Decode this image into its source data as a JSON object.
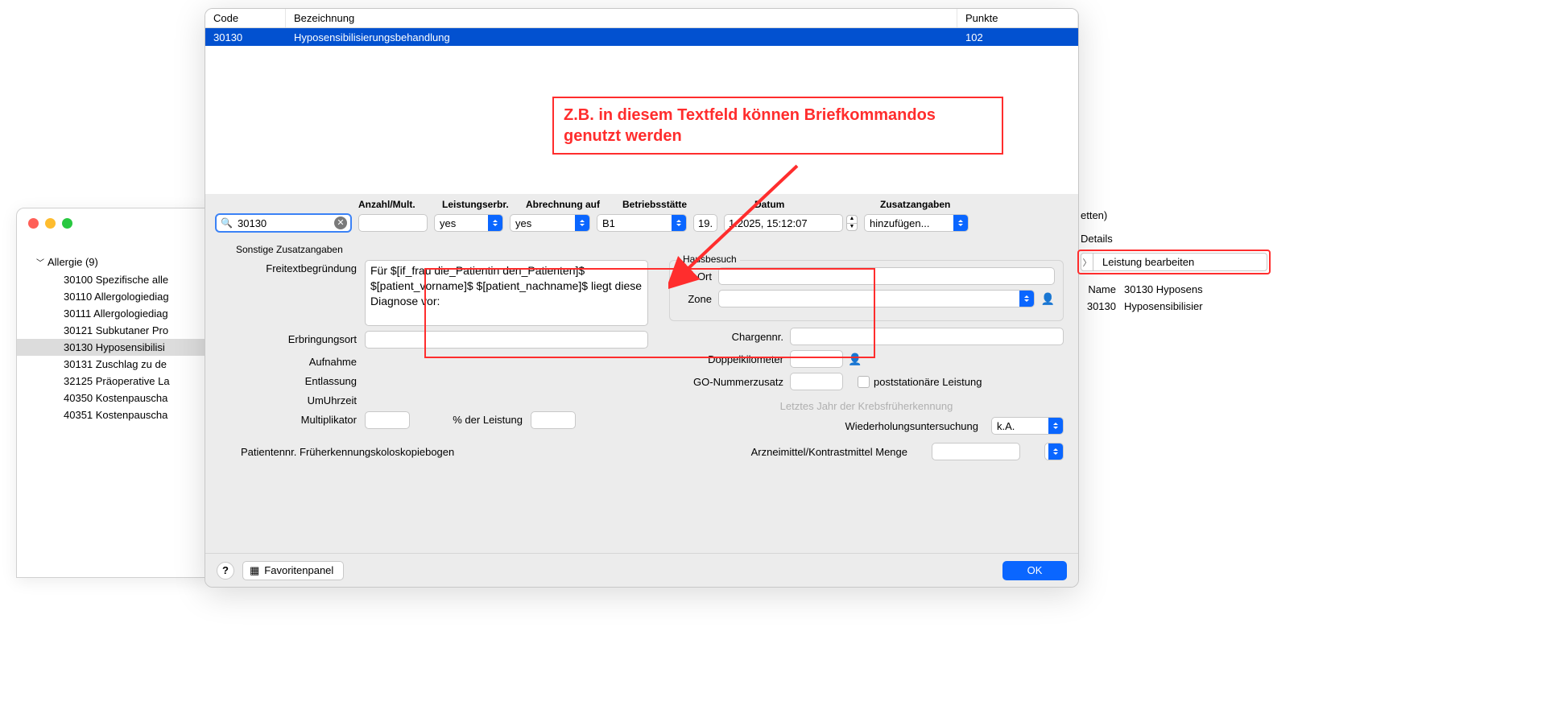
{
  "annotation": {
    "text": "Z.B. in diesem Textfeld können Briefkommandos genutzt werden"
  },
  "bg": {
    "tree_header": "Allergie (9)",
    "tree_items": [
      "30100 Spezifische alle",
      "30110 Allergologiediag",
      "30111 Allergologiediag",
      "30121 Subkutaner Pro",
      "30130 Hyposensibilisi",
      "30131 Zuschlag zu de",
      "32125 Präoperative La",
      "40350 Kostenpauscha",
      "40351 Kostenpauscha"
    ],
    "selected_index": 4
  },
  "table": {
    "head_code": "Code",
    "head_bez": "Bezeichnung",
    "head_pkt": "Punkte",
    "row_code": "30130",
    "row_bez": "Hyposensibilisierungsbehandlung",
    "row_pkt": "102"
  },
  "bar": {
    "lbl_anz": "Anzahl/Mult.",
    "lbl_leist": "Leistungserbr.",
    "lbl_abr": "Abrechnung auf",
    "lbl_bet": "Betriebsstätte",
    "lbl_dat": "Datum",
    "lbl_zus": "Zusatzangaben",
    "search": "30130",
    "anz": "",
    "leist": "yes",
    "abr": "yes",
    "bet": "B1",
    "datum_a": "19.",
    "datum_b": "1.2025, 15:12:07",
    "zus": "hinzufügen..."
  },
  "form": {
    "group": "Sonstige Zusatzangaben",
    "freitext_lbl": "Freitextbegründung",
    "freitext": "Für $[if_frau die_Patientin den_Patienten]$ $[patient_vorname]$ $[patient_nachname]$ liegt diese Diagnose vor:",
    "erbr_lbl": "Erbringungsort",
    "aufn_lbl": "Aufnahme",
    "entl_lbl": "Entlassung",
    "uhr_lbl": "UmUhrzeit",
    "mult_lbl": "Multiplikator",
    "pct_lbl": "% der Leistung",
    "hausbesuch": "Hausbesuch",
    "ort_lbl": "Ort",
    "zone_lbl": "Zone",
    "zone_val": "",
    "chargen_lbl": "Chargennr.",
    "doppel_lbl": "Doppelkilometer",
    "gonum_lbl": "GO-Nummerzusatz",
    "poststat_lbl": "poststationäre Leistung",
    "krebs_lbl": "Letztes Jahr der Krebsfrüherkennung",
    "wieder_lbl": "Wiederholungsuntersuchung",
    "wieder_val": "k.A.",
    "patnr_lbl": "Patientennr. Früherkennungskoloskopiebogen",
    "arznei_lbl": "Arzneimittel/Kontrastmittel Menge"
  },
  "bottom": {
    "help": "?",
    "fav": "Favoritenpanel",
    "ok": "OK"
  },
  "right": {
    "etten": "etten)",
    "details": "Details",
    "leist_btn": "Leistung bearbeiten",
    "name_lbl": "Name",
    "name_val": "30130 Hyposens",
    "code": "30130",
    "desc": "Hyposensibilisier"
  }
}
